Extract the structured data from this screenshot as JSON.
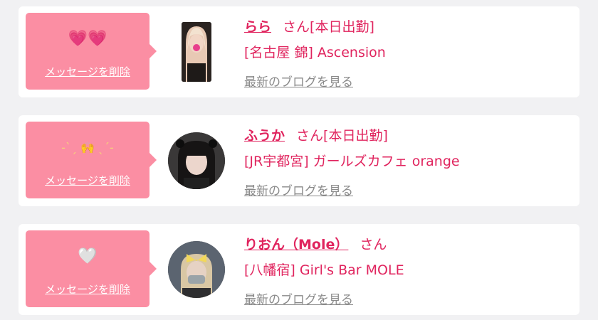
{
  "messages": [
    {
      "emoji": "💗💗",
      "delete_label": "メッセージを削除",
      "name": "らら",
      "honorific": "さん",
      "status": "[本日出勤]",
      "shop": "[名古屋 錦] Ascension",
      "blog_label": "最新のブログを見る"
    },
    {
      "emoji": "-ˋˏ 🙌 ˎˊ-",
      "delete_label": "メッセージを削除",
      "name": "ふうか",
      "honorific": "さん",
      "status": "[本日出勤]",
      "shop": "[JR宇都宮] ガールズカフェ orange",
      "blog_label": "最新のブログを見る"
    },
    {
      "emoji": "🤍",
      "delete_label": "メッセージを削除",
      "name": "りおん（Mole）",
      "honorific": "さん",
      "status": "",
      "shop": "[八幡宿] Girl's Bar MOLE",
      "blog_label": "最新のブログを見る"
    }
  ]
}
